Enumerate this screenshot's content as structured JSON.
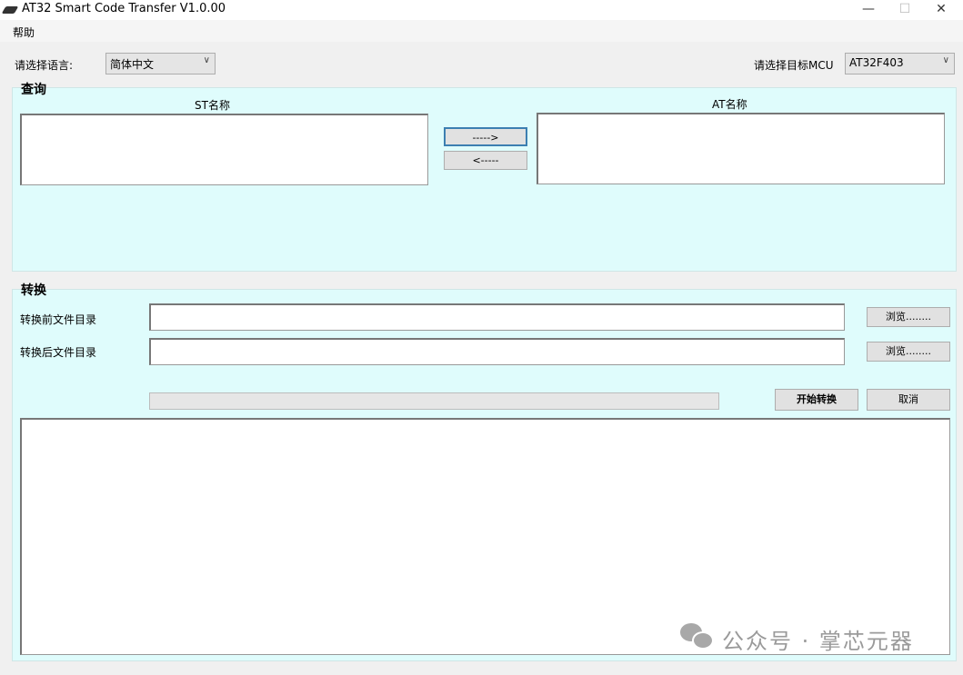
{
  "window": {
    "title": "AT32 Smart Code Transfer V1.0.00",
    "minimize": "—",
    "maximize": "☐",
    "close": "✕"
  },
  "menu": {
    "help": "帮助"
  },
  "top": {
    "language_label": "请选择语言:",
    "language_value": "简体中文",
    "mcu_label": "请选择目标MCU",
    "mcu_value": "AT32F403"
  },
  "query": {
    "title": "查询",
    "st_label": "ST名称",
    "at_label": "AT名称",
    "to_at": "----->",
    "to_st": "<-----"
  },
  "convert": {
    "title": "转换",
    "source_label": "转换前文件目录",
    "target_label": "转换后文件目录",
    "source_value": "",
    "target_value": "",
    "browse1": "浏览........",
    "browse2": "浏览........",
    "start": "开始转换",
    "cancel": "取消",
    "progress": 0
  },
  "watermark": "公众号 · 掌芯元器"
}
